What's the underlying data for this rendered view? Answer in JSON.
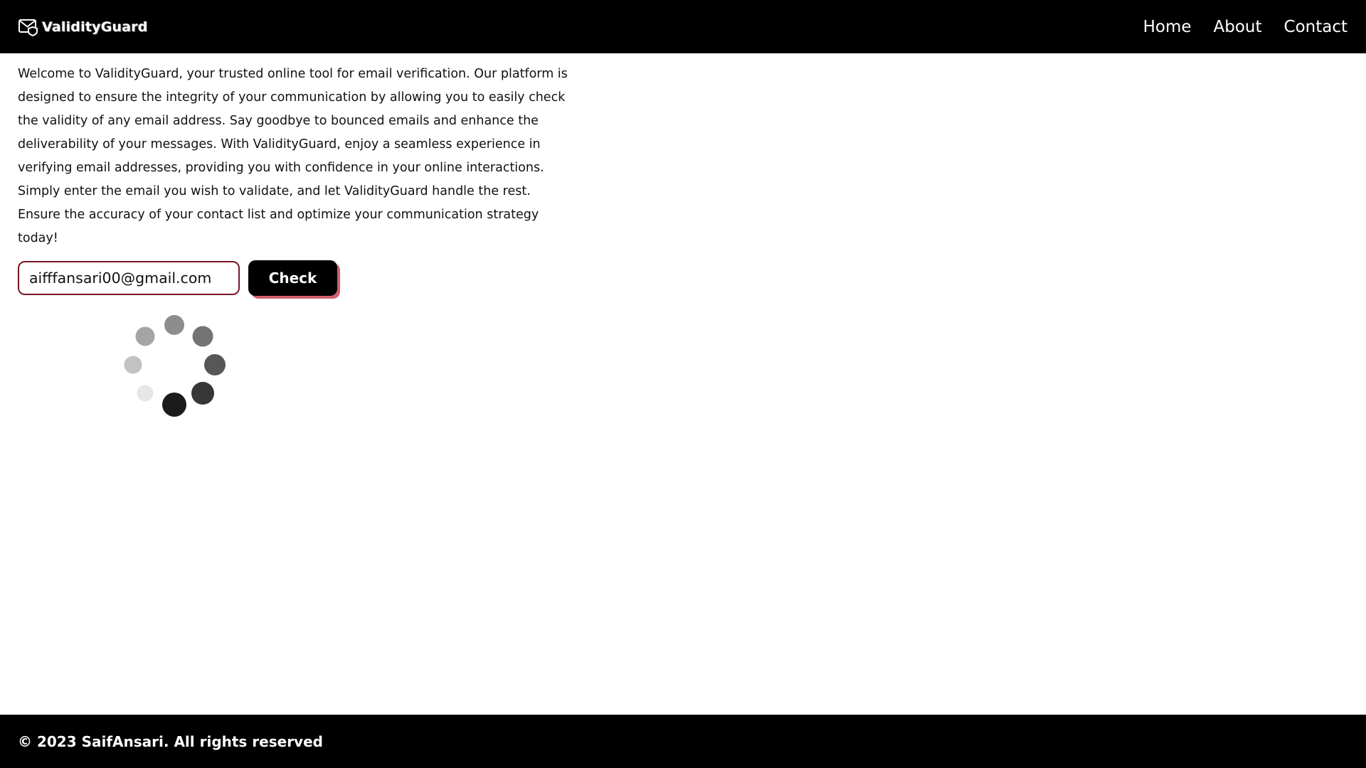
{
  "navbar": {
    "brand_name": "ValidityGuard",
    "brand_icon": "mail-shield-icon",
    "links": [
      {
        "label": "Home"
      },
      {
        "label": "About"
      },
      {
        "label": "Contact"
      }
    ]
  },
  "main": {
    "intro_text": "Welcome to ValidityGuard, your trusted online tool for email verification. Our platform is designed to ensure the integrity of your communication by allowing you to easily check the validity of any email address. Say goodbye to bounced emails and enhance the deliverability of your messages. With ValidityGuard, enjoy a seamless experience in verifying email addresses, providing you with confidence in your online interactions. Simply enter the email you wish to validate, and let ValidityGuard handle the rest. Ensure the accuracy of your contact list and optimize your communication strategy today!",
    "email_value": "aifffansari00@gmail.com",
    "check_label": "Check"
  },
  "spinner": {
    "icon": "loading-spinner-icon",
    "dot_colors": [
      "#8d8d8d",
      "#737373",
      "#575757",
      "#363636",
      "#1b1b1b",
      "#e6e6e6",
      "#c2c2c2",
      "#a5a5a5"
    ]
  },
  "footer": {
    "copyright": "© 2023 SaifAnsari. All rights reserved"
  },
  "colors": {
    "nav_bg": "#000000",
    "input_border": "#7a1426",
    "button_shadow": "#d0606c"
  }
}
